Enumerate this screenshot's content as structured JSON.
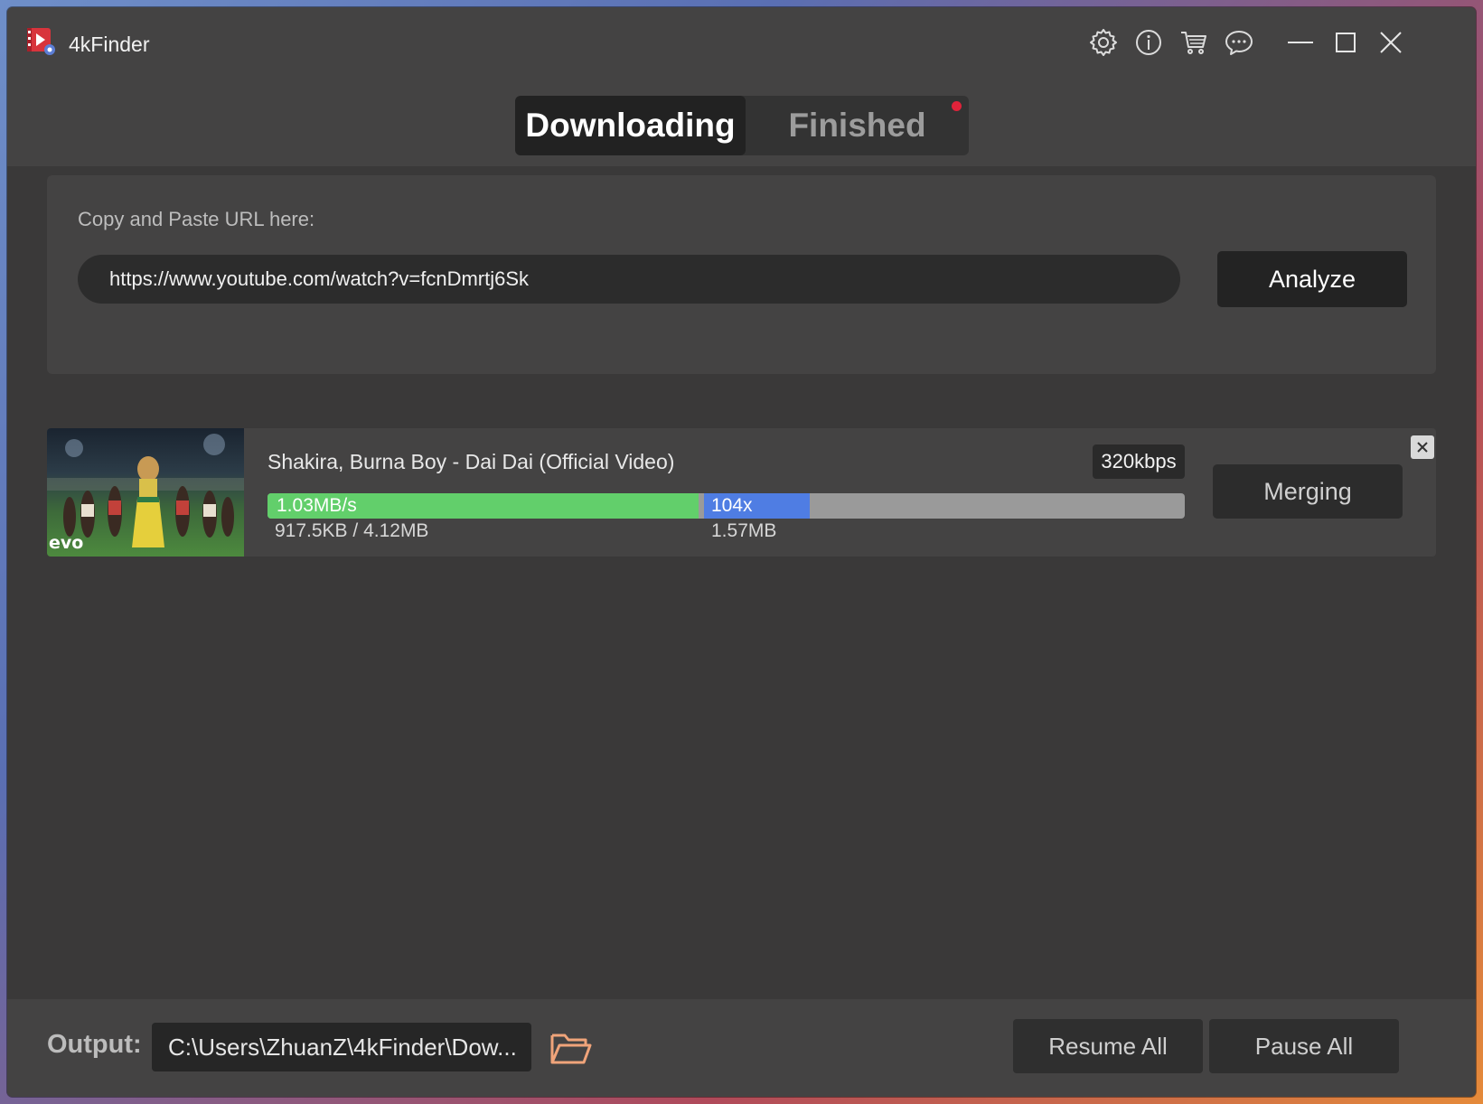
{
  "app": {
    "title": "4kFinder"
  },
  "colors": {
    "accent_red": "#e0233a",
    "progress_green": "#62cf6b",
    "progress_blue": "#4f7de3",
    "track_gray": "#9a9a9a"
  },
  "titlebar_icons": [
    "gear-icon",
    "info-icon",
    "cart-icon",
    "chat-icon",
    "minimize-icon",
    "maximize-icon",
    "close-icon"
  ],
  "tabs": [
    {
      "label": "Downloading",
      "active": true
    },
    {
      "label": "Finished",
      "active": false,
      "has_notification": true
    }
  ],
  "url_panel": {
    "label": "Copy and Paste URL here:",
    "url_value": "https://www.youtube.com/watch?v=fcnDmrtj6Sk",
    "analyze_label": "Analyze"
  },
  "task": {
    "title": "Shakira, Burna Boy - Dai Dai (Official Video)",
    "quality": "320kbps",
    "thumbnail_text": "evo",
    "speed": "1.03MB/s",
    "video_progress": 0.47,
    "video_size": "917.5KB / 4.12MB",
    "audio_speed": "104x",
    "audio_progress": 0.115,
    "audio_size": "1.57MB",
    "status_label": "Merging"
  },
  "footer": {
    "output_label": "Output:",
    "output_path": "C:\\Users\\ZhuanZ\\4kFinder\\Dow...",
    "resume_label": "Resume All",
    "pause_label": "Pause All"
  }
}
